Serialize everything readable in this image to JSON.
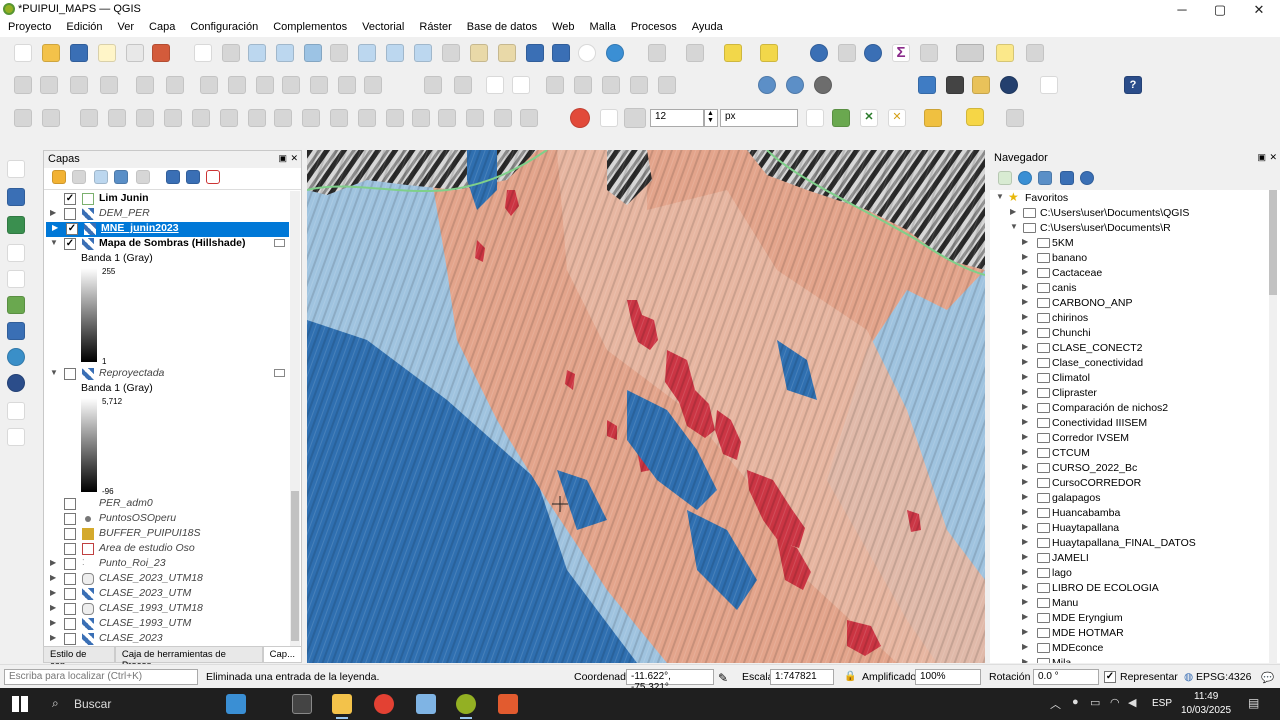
{
  "window": {
    "title": "*PUIPUI_MAPS — QGIS",
    "minimize": "─",
    "maximize": "▢",
    "close": "✕"
  },
  "menu": [
    "Proyecto",
    "Edición",
    "Ver",
    "Capa",
    "Configuración",
    "Complementos",
    "Vectorial",
    "Ráster",
    "Base de datos",
    "Web",
    "Malla",
    "Procesos",
    "Ayuda"
  ],
  "snapping": {
    "tolerance": "12",
    "unit": "px"
  },
  "layers_panel": {
    "title": "Capas",
    "items": [
      {
        "name": "Lim Junin",
        "checked": true,
        "style": "bold",
        "expand": ""
      },
      {
        "name": "DEM_PER",
        "checked": false,
        "style": "ital",
        "expand": "▶"
      },
      {
        "name": "MNE_junin2023",
        "checked": true,
        "style": "bold",
        "expand": "▶",
        "selected": true
      },
      {
        "name": "Mapa de Sombras (Hillshade)",
        "checked": true,
        "style": "bold",
        "expand": "▼"
      },
      {
        "name": "Reproyectada",
        "checked": false,
        "style": "ital",
        "expand": "▼"
      },
      {
        "name": "PER_adm0",
        "checked": false,
        "style": "ital",
        "expand": ""
      },
      {
        "name": "PuntosOSOperu",
        "checked": false,
        "style": "ital",
        "expand": ""
      },
      {
        "name": "BUFFER_PUIPUI18S",
        "checked": false,
        "style": "ital",
        "expand": ""
      },
      {
        "name": "Area de estudio Oso",
        "checked": false,
        "style": "ital",
        "expand": ""
      },
      {
        "name": "Punto_Roi_23",
        "checked": false,
        "style": "ital",
        "expand": "▶"
      },
      {
        "name": "CLASE_2023_UTM18",
        "checked": false,
        "style": "ital",
        "expand": "▶"
      },
      {
        "name": "CLASE_2023_UTM",
        "checked": false,
        "style": "ital",
        "expand": "▶"
      },
      {
        "name": "CLASE_1993_UTM18",
        "checked": false,
        "style": "ital",
        "expand": "▶"
      },
      {
        "name": "CLASE_1993_UTM",
        "checked": false,
        "style": "ital",
        "expand": "▶"
      },
      {
        "name": "CLASE_2023",
        "checked": false,
        "style": "ital",
        "expand": "▶"
      }
    ],
    "legend1": {
      "band": "Banda 1 (Gray)",
      "max": "255",
      "min": "1"
    },
    "legend2": {
      "band": "Banda 1 (Gray)",
      "max": "5,712",
      "min": "-96"
    },
    "tabs": [
      "Estilo de cap...",
      "Caja de herramientas de Proces...",
      "Cap..."
    ]
  },
  "browser": {
    "title": "Navegador",
    "favorites": "Favoritos",
    "items": [
      "C:\\Users\\user\\Documents\\QGIS",
      "C:\\Users\\user\\Documents\\R",
      "5KM",
      "banano",
      "Cactaceae",
      "canis",
      "CARBONO_ANP",
      "chirinos",
      "Chunchi",
      "CLASE_CONECT2",
      "Clase_conectividad",
      "Climatol",
      "Clipraster",
      "Comparación de nichos2",
      "Conectividad IIISEM",
      "Corredor IVSEM",
      "CTCUM",
      "CURSO_2022_Bc",
      "CursoCORREDOR",
      "galapagos",
      "Huancabamba",
      "Huaytapallana",
      "Huaytapallana_FINAL_DATOS",
      "JAMELI",
      "lago",
      "LIBRO DE ECOLOGIA",
      "Manu",
      "MDE Eryngium",
      "MDE HOTMAR",
      "MDEconce",
      "Mila"
    ]
  },
  "status": {
    "search_placeholder": "Escriba para localizar (Ctrl+K)",
    "message": "Eliminada una entrada de la leyenda.",
    "coord_label": "Coordenada",
    "coord": "-11.622°, -75.321°",
    "scale_label": "Escala",
    "scale": "1:747821",
    "magnifier_label": "Amplificador",
    "magnifier": "100%",
    "rotation_label": "Rotación",
    "rotation": "0.0 °",
    "render_label": "Representar",
    "crs": "EPSG:4326"
  },
  "taskbar": {
    "search": "Buscar",
    "lang": "ESP",
    "time": "11:49",
    "date": "10/03/2025"
  }
}
